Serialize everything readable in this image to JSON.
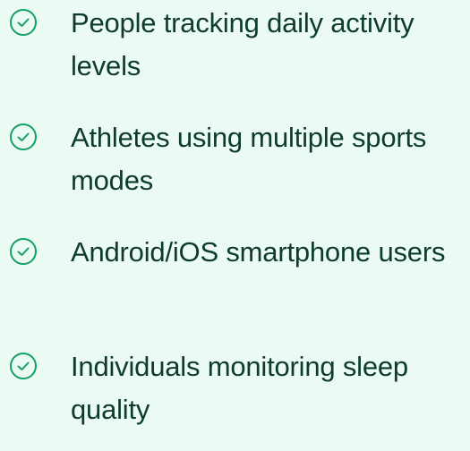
{
  "colors": {
    "background": "#ebfbf4",
    "text": "#0e3b2f",
    "check_icon": "#12a06a"
  },
  "items": [
    {
      "icon": "check-circle-icon",
      "label": "People tracking daily activity levels"
    },
    {
      "icon": "check-circle-icon",
      "label": "Athletes using multiple sports modes"
    },
    {
      "icon": "check-circle-icon",
      "label": "Android/iOS smartphone users"
    },
    {
      "icon": "check-circle-icon",
      "label": "Individuals monitoring sleep quality"
    }
  ]
}
